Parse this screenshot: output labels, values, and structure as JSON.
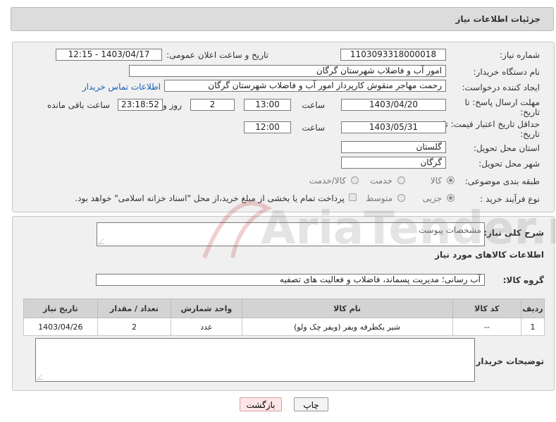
{
  "header": {
    "title": "جزئیات اطلاعات نیاز"
  },
  "form": {
    "need_number_label": "شماره نیاز:",
    "need_number": "1103093318000018",
    "announce_label": "تاریخ و ساعت اعلان عمومی:",
    "announce_value": "1403/04/17 - 12:15",
    "buyer_org_label": "نام دستگاه خریدار:",
    "buyer_org": "امور آب و فاضلاب شهرستان گرگان",
    "creator_label": "ایجاد کننده درخواست:",
    "creator": "رحمت مهاجر منقوش کارپرداز امور آب و فاضلاب شهرستان گرگان",
    "contact_link": "اطلاعات تماس خریدار",
    "deadline_label_1": "مهلت ارسال پاسخ: تا",
    "deadline_label_2": "تاریخ:",
    "deadline_date": "1403/04/20",
    "time_label": "ساعت",
    "deadline_time": "13:00",
    "days_value": "2",
    "days_label": "روز و",
    "remaining_time": "23:18:52",
    "remaining_label": "ساعت باقی مانده",
    "validity_label_1": "حداقل تاریخ اعتبار قیمت: تا",
    "validity_label_2": "تاریخ:",
    "validity_date": "1403/05/31",
    "validity_time": "12:00",
    "province_label": "استان محل تحویل:",
    "province": "گلستان",
    "city_label": "شهر محل تحویل:",
    "city": "گرگان",
    "category_label": "طبقه بندی موضوعی:",
    "category_options": [
      "کالا",
      "خدمت",
      "کالا/خدمت"
    ],
    "category_selected": "کالا",
    "process_label": "نوع فرآیند خرید :",
    "process_options": [
      "جزیی",
      "متوسط"
    ],
    "process_selected": "جزیی",
    "payment_note": "پرداخت تمام یا بخشی از مبلغ خرید،از محل \"اسناد خزانه اسلامی\" خواهد بود."
  },
  "details": {
    "description_label": "شرح کلی نیاز:",
    "description_value": "مشخصات پیوست",
    "goods_info_title": "اطلاعات کالاهای مورد نیاز",
    "goods_group_label": "گروه کالا:",
    "goods_group_value": "آب رسانی؛ مدیریت پسماند، فاضلاب و فعالیت های تصفیه",
    "table": {
      "headers": [
        "ردیف",
        "کد کالا",
        "نام کالا",
        "واحد شمارش",
        "تعداد / مقدار",
        "تاریخ نیاز"
      ],
      "rows": [
        [
          "1",
          "--",
          "شیر یکطرفه ویفر (ویفر چک ولو)",
          "عدد",
          "2",
          "1403/04/26"
        ]
      ]
    },
    "buyer_notes_label": "توضیحات خریدار:",
    "buyer_notes_value": ""
  },
  "buttons": {
    "print": "چاپ",
    "back": "بازگشت"
  },
  "watermark": {
    "text": "AriaTender.net"
  }
}
